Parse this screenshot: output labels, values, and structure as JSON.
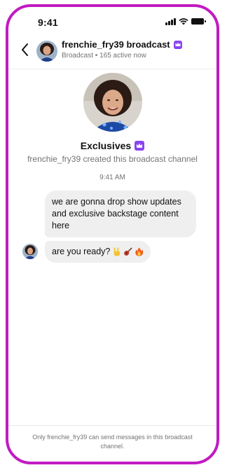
{
  "status_bar": {
    "time": "9:41",
    "icons": [
      "cellular-signal-icon",
      "wifi-icon",
      "battery-icon"
    ]
  },
  "header": {
    "back_icon": "chevron-left-icon",
    "title": "frenchie_fry39 broadcast",
    "badge_icon": "crown-icon",
    "subtitle": "Broadcast • 165 active now"
  },
  "channel": {
    "name": "Exclusives",
    "badge_icon": "crown-icon",
    "created_text": "frenchie_fry39 created this broadcast channel"
  },
  "conversation": {
    "timestamp": "9:41 AM",
    "messages": [
      {
        "text": "we are gonna drop show updates and exclusive backstage content here"
      },
      {
        "text": "are you ready?",
        "emojis": [
          "rock-on-hand-icon",
          "guitar-icon",
          "fire-icon"
        ]
      }
    ]
  },
  "footer": {
    "notice": "Only frenchie_fry39 can send messages in this broadcast channel."
  },
  "colors": {
    "frame_border": "#c11bc1",
    "badge_purple": "#8a44f0",
    "bubble_bg": "#efefef",
    "muted_text": "#737373"
  }
}
